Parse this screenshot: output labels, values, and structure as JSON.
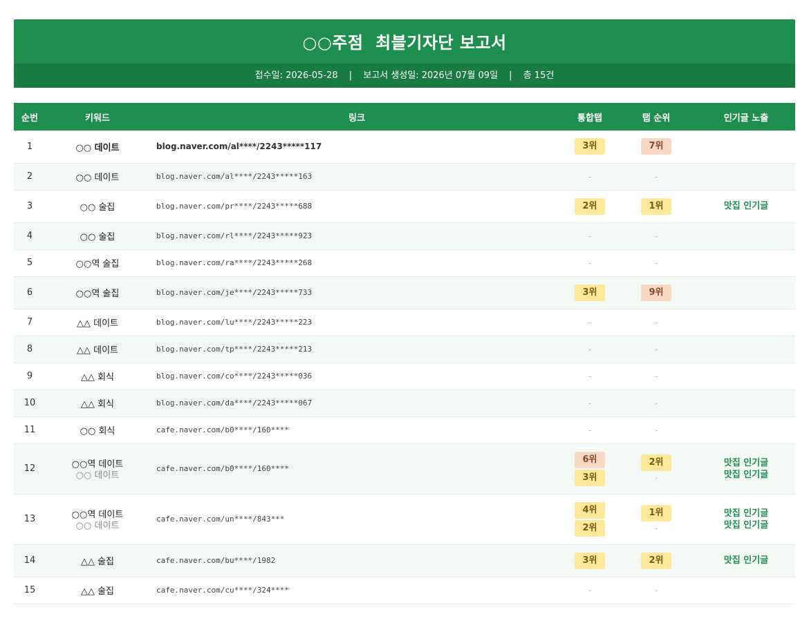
{
  "report": {
    "title": "○○주점  최블기자단 보고서",
    "received": "접수일: 2026-05-28",
    "generated": "보고서 생성일: 2026년 07월 09일",
    "total": "총 15건",
    "separator": "|"
  },
  "table": {
    "headers": {
      "no": "순번",
      "keyword": "키워드",
      "link": "링크",
      "integrated": "통합탭",
      "tabrank": "탭 순위",
      "popular": "인기글 노출"
    },
    "rows": [
      {
        "no": "1",
        "keyword": "○○ 데이트",
        "link": "blog.naver.com/al****/2243*****117",
        "integrated": [
          "3위"
        ],
        "tabrank": [
          "7위"
        ],
        "popular": []
      },
      {
        "no": "2",
        "keyword": "○○ 데이트",
        "link": "blog.naver.com/al****/2243*****163",
        "integrated": [
          "-"
        ],
        "tabrank": [
          "-"
        ],
        "popular": []
      },
      {
        "no": "3",
        "keyword": "○○ 술집",
        "link": "blog.naver.com/pr****/2243*****688",
        "integrated": [
          "2위"
        ],
        "tabrank": [
          "1위"
        ],
        "popular": [
          "맛집 인기글"
        ]
      },
      {
        "no": "4",
        "keyword": "○○ 술집",
        "link": "blog.naver.com/rl****/2243*****923",
        "integrated": [
          "-"
        ],
        "tabrank": [
          "-"
        ],
        "popular": []
      },
      {
        "no": "5",
        "keyword": "○○역 술집",
        "link": "blog.naver.com/ra****/2243*****268",
        "integrated": [
          "-"
        ],
        "tabrank": [
          "-"
        ],
        "popular": []
      },
      {
        "no": "6",
        "keyword": "○○역 술집",
        "link": "blog.naver.com/je****/2243*****733",
        "integrated": [
          "3위"
        ],
        "tabrank": [
          "9위"
        ],
        "popular": []
      },
      {
        "no": "7",
        "keyword": "△△ 데이트",
        "link": "blog.naver.com/lu****/2243*****223",
        "integrated": [
          "-"
        ],
        "tabrank": [
          "-"
        ],
        "popular": []
      },
      {
        "no": "8",
        "keyword": "△△ 데이트",
        "link": "blog.naver.com/tp****/2243*****213",
        "integrated": [
          "-"
        ],
        "tabrank": [
          "-"
        ],
        "popular": []
      },
      {
        "no": "9",
        "keyword": "△△ 회식",
        "link": "blog.naver.com/co****/2243*****036",
        "integrated": [
          "-"
        ],
        "tabrank": [
          "-"
        ],
        "popular": []
      },
      {
        "no": "10",
        "keyword": "△△ 회식",
        "link": "blog.naver.com/da****/2243*****067",
        "integrated": [
          "-"
        ],
        "tabrank": [
          "-"
        ],
        "popular": []
      },
      {
        "no": "11",
        "keyword": "○○ 회식",
        "link": "cafe.naver.com/b0****/160****",
        "integrated": [
          "-"
        ],
        "tabrank": [
          "-"
        ],
        "popular": []
      },
      {
        "no": "12",
        "keyword": "○○역 데이트",
        "keyword_sub": "○○ 데이트",
        "link": "cafe.naver.com/b0****/160****",
        "integrated": [
          "6위",
          "3위"
        ],
        "tabrank": [
          "2위",
          "-"
        ],
        "popular": [
          "맛집 인기글",
          "맛집 인기글"
        ]
      },
      {
        "no": "13",
        "keyword": "○○역 데이트",
        "keyword_sub": "○○ 데이트",
        "link": "cafe.naver.com/un****/843***",
        "integrated": [
          "4위",
          "2위"
        ],
        "tabrank": [
          "1위",
          "-"
        ],
        "popular": [
          "맛집 인기글",
          "맛집 인기글"
        ]
      },
      {
        "no": "14",
        "keyword": "△△ 술집",
        "link": "cafe.naver.com/bu****/1982",
        "integrated": [
          "3위"
        ],
        "tabrank": [
          "2위"
        ],
        "popular": [
          "맛집 인기글"
        ]
      },
      {
        "no": "15",
        "keyword": "△△ 술집",
        "link": "cafe.naver.com/cu****/324****",
        "integrated": [
          "-"
        ],
        "tabrank": [
          "-"
        ],
        "popular": []
      }
    ]
  },
  "colors": {
    "primary": "#1e8f4e",
    "primary_dark": "#187c42",
    "rank_top3": "#fde89a",
    "rank_other": "#f8d7c4",
    "popular_text": "#1e8f4e"
  }
}
